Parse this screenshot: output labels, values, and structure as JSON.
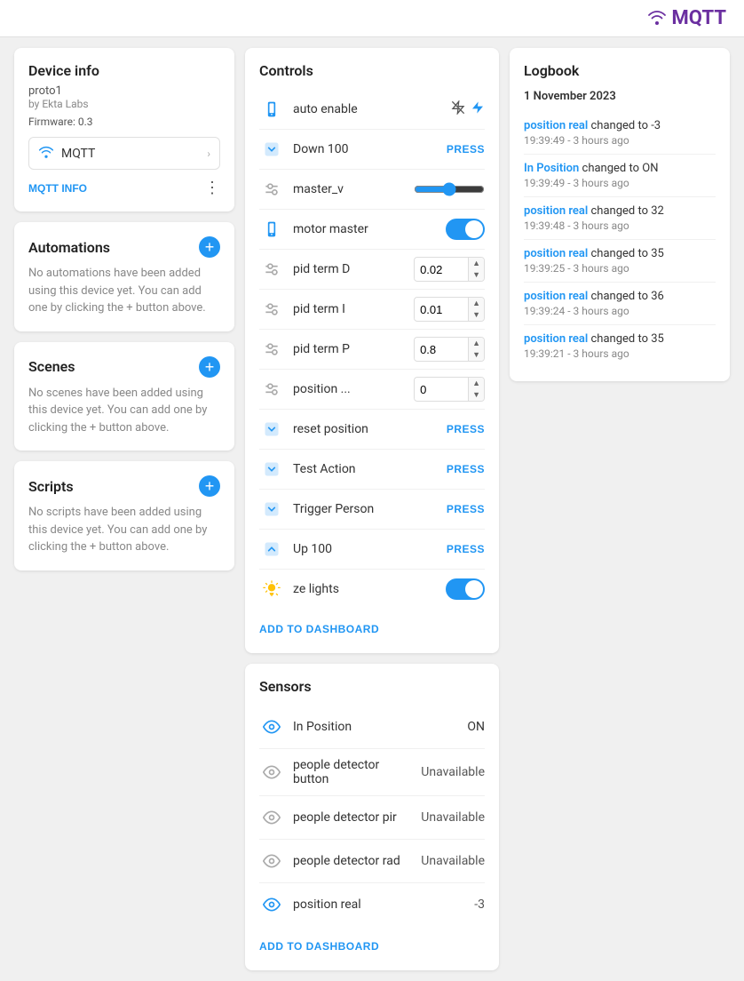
{
  "topbar": {
    "logo_text": "MQTT"
  },
  "device_info": {
    "title": "Device info",
    "name": "proto1",
    "by": "by Ekta Labs",
    "firmware": "Firmware: 0.3",
    "mqtt_label": "MQTT",
    "mqtt_info_btn": "MQTT INFO"
  },
  "automations": {
    "title": "Automations",
    "empty_text": "No automations have been added using this device yet. You can add one by clicking the + button above."
  },
  "scenes": {
    "title": "Scenes",
    "empty_text": "No scenes have been added using this device yet. You can add one by clicking the + button above."
  },
  "scripts": {
    "title": "Scripts",
    "empty_text": "No scripts have been added using this device yet. You can add one by clicking the + button above."
  },
  "controls": {
    "title": "Controls",
    "add_dashboard_btn": "ADD TO DASHBOARD",
    "items": [
      {
        "id": "auto-enable",
        "label": "auto enable",
        "type": "icons",
        "icon_type": "phone"
      },
      {
        "id": "down-100",
        "label": "Down 100",
        "type": "press",
        "icon_type": "action"
      },
      {
        "id": "master-v",
        "label": "master_v",
        "type": "slider",
        "icon_type": "slider",
        "value": 50
      },
      {
        "id": "motor-master",
        "label": "motor master",
        "type": "toggle",
        "icon_type": "phone",
        "on": true
      },
      {
        "id": "pid-term-d",
        "label": "pid term D",
        "type": "number",
        "icon_type": "slider",
        "value": "0.02"
      },
      {
        "id": "pid-term-i",
        "label": "pid term I",
        "type": "number",
        "icon_type": "slider",
        "value": "0.01"
      },
      {
        "id": "pid-term-p",
        "label": "pid term P",
        "type": "number",
        "icon_type": "slider",
        "value": "0.8"
      },
      {
        "id": "position",
        "label": "position ...",
        "type": "number",
        "icon_type": "slider",
        "value": "0"
      },
      {
        "id": "reset-position",
        "label": "reset position",
        "type": "press",
        "icon_type": "action"
      },
      {
        "id": "test-action",
        "label": "Test Action",
        "type": "press",
        "icon_type": "action"
      },
      {
        "id": "trigger-person",
        "label": "Trigger Person",
        "type": "press",
        "icon_type": "action"
      },
      {
        "id": "up-100",
        "label": "Up 100",
        "type": "press",
        "icon_type": "action"
      },
      {
        "id": "ze-lights",
        "label": "ze lights",
        "type": "toggle",
        "icon_type": "light",
        "on": true
      }
    ]
  },
  "sensors": {
    "title": "Sensors",
    "add_dashboard_btn": "ADD TO DASHBOARD",
    "items": [
      {
        "id": "in-position",
        "label": "In Position",
        "value": "ON",
        "highlight": false
      },
      {
        "id": "people-detector-button",
        "label": "people detector button",
        "value": "Unavailable",
        "highlight": false
      },
      {
        "id": "people-detector-pir",
        "label": "people detector pir",
        "value": "Unavailable",
        "highlight": false
      },
      {
        "id": "people-detector-rad",
        "label": "people detector rad",
        "value": "Unavailable",
        "highlight": false
      },
      {
        "id": "position-real",
        "label": "position real",
        "value": "-3",
        "highlight": false
      }
    ]
  },
  "logbook": {
    "title": "Logbook",
    "date": "1 November 2023",
    "entries": [
      {
        "text_link": "position real",
        "text_normal": " changed to -3",
        "time": "19:39:49 - 3 hours ago"
      },
      {
        "text_link": "In Position",
        "text_normal": " changed to ON",
        "time": "19:39:49 - 3 hours ago"
      },
      {
        "text_link": "position real",
        "text_normal": " changed to 32",
        "time": "19:39:48 - 3 hours ago"
      },
      {
        "text_link": "position real",
        "text_normal": " changed to 35",
        "time": "19:39:25 - 3 hours ago"
      },
      {
        "text_link": "position real",
        "text_normal": " changed to 36",
        "time": "19:39:24 - 3 hours ago"
      },
      {
        "text_link": "position real",
        "text_normal": " changed to 35",
        "time": "19:39:21 - 3 hours ago"
      }
    ]
  }
}
